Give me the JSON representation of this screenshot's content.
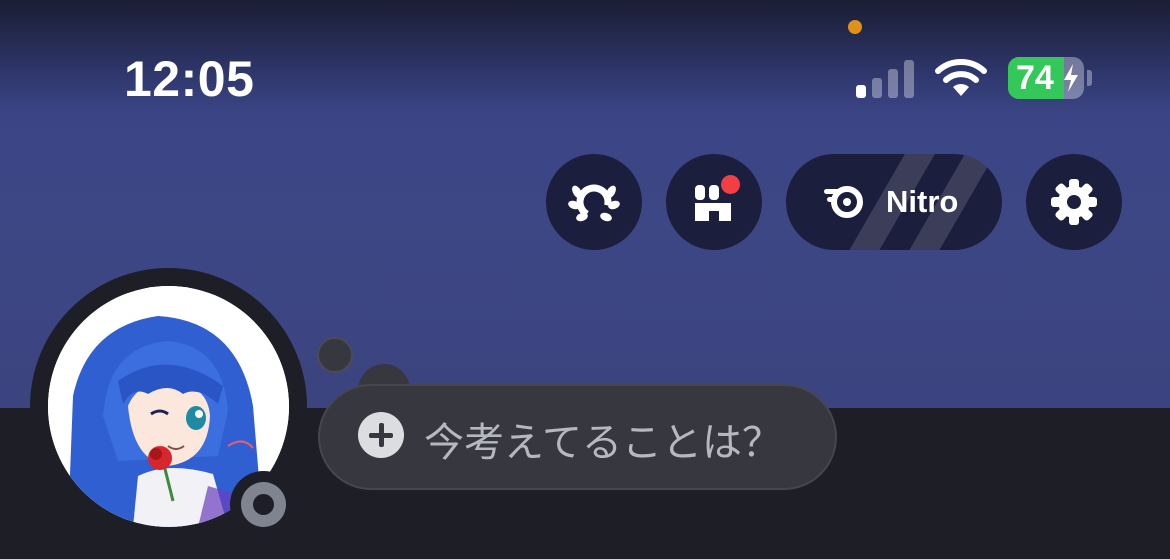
{
  "status_bar": {
    "time": "12:05",
    "battery_level": "74",
    "battery_fraction": 0.74,
    "cellular_bars_active": 1,
    "cellular_bars_total": 4,
    "privacy_indicator_color": "#e0911a"
  },
  "header_actions": {
    "quests_icon": "laurel-wreath-icon",
    "shop_icon": "shop-icon",
    "shop_has_notification": true,
    "nitro_label": "Nitro",
    "settings_icon": "gear-icon"
  },
  "profile": {
    "avatar": "anime-girl-blue-hair-holding-rose",
    "presence": "offline",
    "presence_color": "#80848e"
  },
  "custom_status": {
    "placeholder": "今考えてることは？",
    "add_icon": "plus-icon"
  },
  "colors": {
    "banner": "#3d4785",
    "button_bg": "#1c1e3e",
    "notification": "#f23f43",
    "battery_fill": "#34c759"
  }
}
